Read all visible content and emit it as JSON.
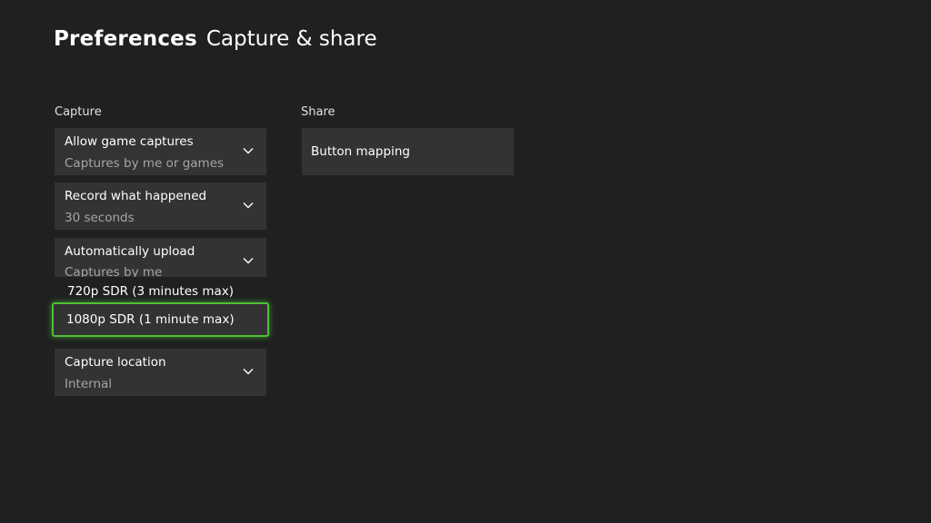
{
  "header": {
    "title": "Preferences",
    "subtitle": "Capture & share"
  },
  "capture": {
    "label": "Capture",
    "tiles": [
      {
        "title": "Allow game captures",
        "value": "Captures by me or games"
      },
      {
        "title": "Record what happened",
        "value": "30 seconds"
      },
      {
        "title": "Automatically upload",
        "value": "Captures by me"
      },
      {
        "title": "Capture location",
        "value": "Internal"
      }
    ],
    "dropdown_options": [
      "720p SDR (3 minutes max)",
      "1080p SDR (1 minute max)"
    ],
    "focused_option": "1080p SDR (1 minute max)"
  },
  "share": {
    "label": "Share",
    "tiles": [
      {
        "title": "Button mapping"
      }
    ]
  },
  "colors": {
    "background": "#202020",
    "tile": "#333333",
    "focus": "#4fbf3a",
    "secondary_text": "#a6a6a6"
  },
  "icons": {
    "chevron": "chevron-down-icon"
  }
}
